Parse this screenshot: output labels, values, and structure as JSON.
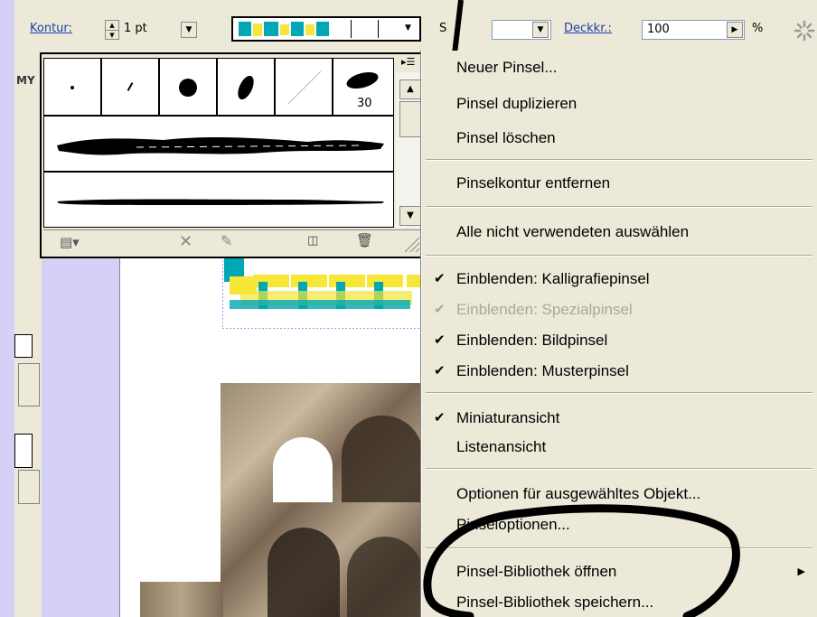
{
  "toolbar": {
    "kontur_label": "Kontur:",
    "kontur_value": "1 pt",
    "s_label": "S",
    "deckkraft_label": "Deckkr.:",
    "deckkraft_value": "100",
    "percent": "%"
  },
  "palette": {
    "brush_size_label": "30",
    "side_label": "MY"
  },
  "menu": {
    "items": [
      {
        "label": "Neuer Pinsel...",
        "checked": false,
        "disabled": false
      },
      {
        "label": "Pinsel duplizieren",
        "checked": false,
        "disabled": false
      },
      {
        "label": "Pinsel löschen",
        "checked": false,
        "disabled": false
      },
      {
        "label": "Pinselkontur entfernen",
        "checked": false,
        "disabled": false
      },
      {
        "label": "Alle nicht verwendeten auswählen",
        "checked": false,
        "disabled": false
      },
      {
        "label": "Einblenden: Kalligrafiepinsel",
        "checked": true,
        "disabled": false
      },
      {
        "label": "Einblenden: Spezialpinsel",
        "checked": true,
        "disabled": true
      },
      {
        "label": "Einblenden: Bildpinsel",
        "checked": true,
        "disabled": false
      },
      {
        "label": "Einblenden: Musterpinsel",
        "checked": true,
        "disabled": false
      },
      {
        "label": "Miniaturansicht",
        "checked": true,
        "disabled": false
      },
      {
        "label": "Listenansicht",
        "checked": false,
        "disabled": false
      },
      {
        "label": "Optionen für ausgewähltes Objekt...",
        "checked": false,
        "disabled": false
      },
      {
        "label": "Pinseloptionen...",
        "checked": false,
        "disabled": false
      },
      {
        "label": "Pinsel-Bibliothek öffnen",
        "checked": false,
        "disabled": false
      },
      {
        "label": "Pinsel-Bibliothek speichern...",
        "checked": false,
        "disabled": false
      }
    ]
  },
  "icons": [
    "spinner-icon",
    "palette-menu-icon",
    "brush-library-icon",
    "remove-stroke-icon",
    "brush-options-icon",
    "new-brush-icon",
    "delete-brush-icon",
    "resize-grip-icon",
    "checkmark-icon",
    "submenu-arrow-icon"
  ],
  "colors": {
    "menu_bg": "#ece9d8",
    "label_blue": "#1b3ea8",
    "disabled": "#aca899",
    "page_bg": "#d4d0f6"
  }
}
